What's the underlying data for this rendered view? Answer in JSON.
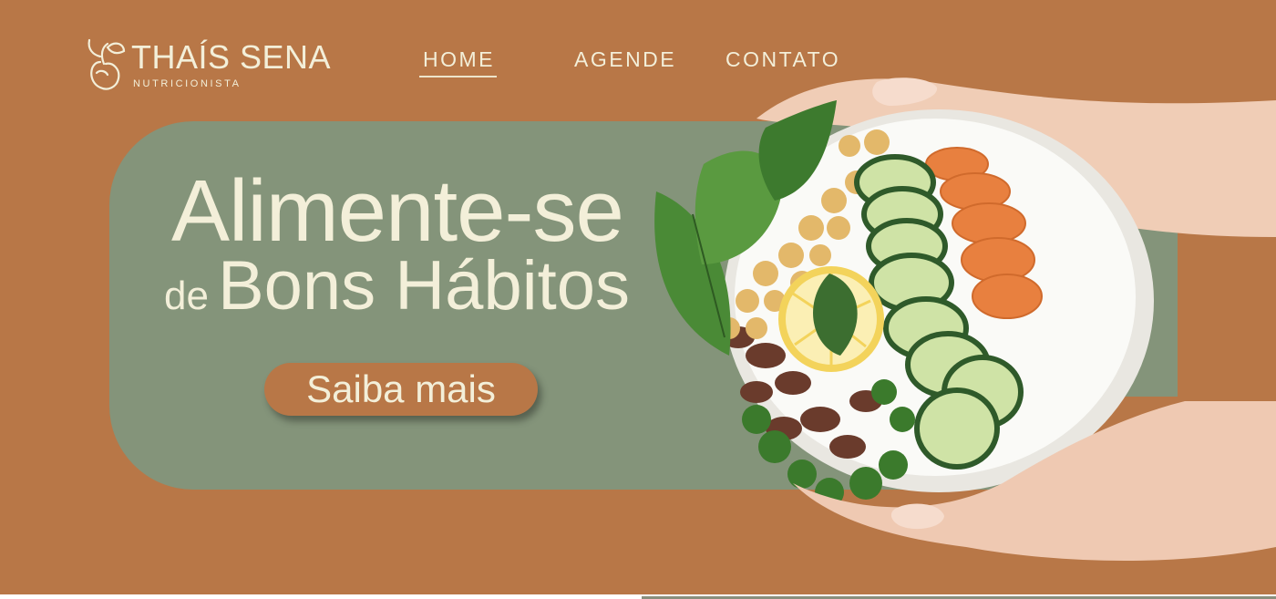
{
  "brand": {
    "name": "THAÍS SENA",
    "tagline": "NUTRICIONISTA"
  },
  "nav": {
    "items": [
      {
        "label": "HOME",
        "active": true
      },
      {
        "label": "AGENDE",
        "active": false
      },
      {
        "label": "CONTATO",
        "active": false
      }
    ]
  },
  "hero": {
    "headline_line1": "Alimente-se",
    "headline_line2_small": "de",
    "headline_line2_big": "Bons Hábitos",
    "cta_label": "Saiba mais"
  },
  "colors": {
    "background": "#b87747",
    "card": "#84947a",
    "text": "#f3efd9"
  },
  "icons": {
    "logo": "leaf-apple-logo-icon",
    "hero_image": "hands-holding-salad-bowl"
  }
}
